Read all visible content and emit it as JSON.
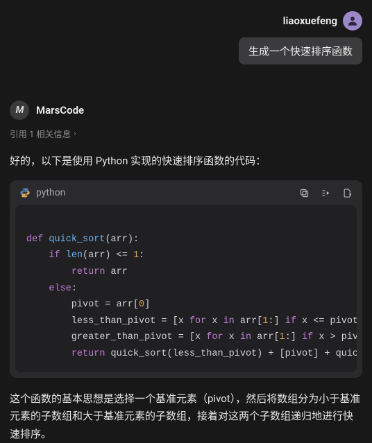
{
  "user": {
    "name": "liaoxuefeng",
    "prompt": "生成一个快速排序函数"
  },
  "bot": {
    "name": "MarsCode",
    "avatar_text": "M",
    "reference_line": "引用 1 相关信息",
    "intro": "好的，以下是使用 Python 实现的快速排序函数的代码：",
    "outro": "这个函数的基本思想是选择一个基准元素（pivot），然后将数组分为小于基准元素的子数组和大于基准元素的子数组，接着对这两个子数组递归地进行快速排序。"
  },
  "code": {
    "language": "python",
    "tokens": [
      [
        {
          "t": "k",
          "v": "def"
        },
        {
          "t": "p",
          "v": " "
        },
        {
          "t": "fn",
          "v": "quick_sort"
        },
        {
          "t": "p",
          "v": "(arr):"
        }
      ],
      [
        {
          "t": "p",
          "v": "    "
        },
        {
          "t": "k",
          "v": "if"
        },
        {
          "t": "p",
          "v": " "
        },
        {
          "t": "fn",
          "v": "len"
        },
        {
          "t": "p",
          "v": "(arr) <= "
        },
        {
          "t": "num",
          "v": "1"
        },
        {
          "t": "p",
          "v": ":"
        }
      ],
      [
        {
          "t": "p",
          "v": "        "
        },
        {
          "t": "k",
          "v": "return"
        },
        {
          "t": "p",
          "v": " arr"
        }
      ],
      [
        {
          "t": "p",
          "v": "    "
        },
        {
          "t": "k",
          "v": "else"
        },
        {
          "t": "p",
          "v": ":"
        }
      ],
      [
        {
          "t": "p",
          "v": "        pivot = arr["
        },
        {
          "t": "num",
          "v": "0"
        },
        {
          "t": "p",
          "v": "]"
        }
      ],
      [
        {
          "t": "p",
          "v": "        less_than_pivot = [x "
        },
        {
          "t": "k",
          "v": "for"
        },
        {
          "t": "p",
          "v": " x "
        },
        {
          "t": "k",
          "v": "in"
        },
        {
          "t": "p",
          "v": " arr["
        },
        {
          "t": "num",
          "v": "1"
        },
        {
          "t": "p",
          "v": ":] "
        },
        {
          "t": "k",
          "v": "if"
        },
        {
          "t": "p",
          "v": " x <= pivot]"
        }
      ],
      [
        {
          "t": "p",
          "v": "        greater_than_pivot = [x "
        },
        {
          "t": "k",
          "v": "for"
        },
        {
          "t": "p",
          "v": " x "
        },
        {
          "t": "k",
          "v": "in"
        },
        {
          "t": "p",
          "v": " arr["
        },
        {
          "t": "num",
          "v": "1"
        },
        {
          "t": "p",
          "v": ":] "
        },
        {
          "t": "k",
          "v": "if"
        },
        {
          "t": "p",
          "v": " x > pivot]"
        }
      ],
      [
        {
          "t": "p",
          "v": "        "
        },
        {
          "t": "k",
          "v": "return"
        },
        {
          "t": "p",
          "v": " quick_sort(less_than_pivot) + [pivot] + quick_sort(greater_than_pivot)"
        }
      ]
    ]
  }
}
